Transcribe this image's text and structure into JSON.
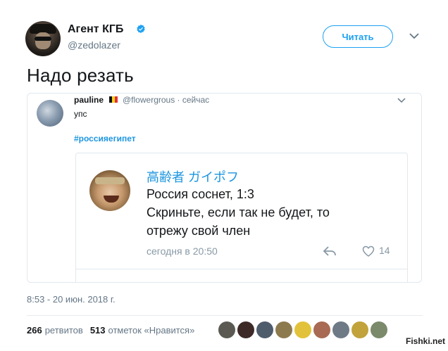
{
  "author": {
    "name": "Агент КГБ",
    "handle": "@zedolazer",
    "verified": true
  },
  "follow_button": "Читать",
  "tweet_text": "Надо резать",
  "quoted": {
    "name": "pauline",
    "meta": "@flowergrous · сейчас",
    "text": "упс",
    "hashtag": "#россияегипет",
    "inner": {
      "name": "高齢者 ガイポフ",
      "line1": "Россия соснет, 1:3",
      "line2": "Скриньте, если так не будет, то",
      "line3": "отрежу  свой член",
      "time": "сегодня в 20:50",
      "likes": "14"
    }
  },
  "timestamp": "8:53 - 20 июн. 2018 г.",
  "stats": {
    "retweets_count": "266",
    "retweets_label": "ретвитов",
    "likes_count": "513",
    "likes_label": "отметок «Нравится»"
  },
  "liker_colors": [
    "#5a5a52",
    "#3d2a26",
    "#4e5c6c",
    "#8c7a4e",
    "#e2c23a",
    "#a86a52",
    "#6e7a86",
    "#c2a23a",
    "#7a8a6a"
  ],
  "watermark": "Fishki.net",
  "colors": {
    "accent": "#1da1f2",
    "link": "#1b95e0",
    "muted": "#657786"
  }
}
